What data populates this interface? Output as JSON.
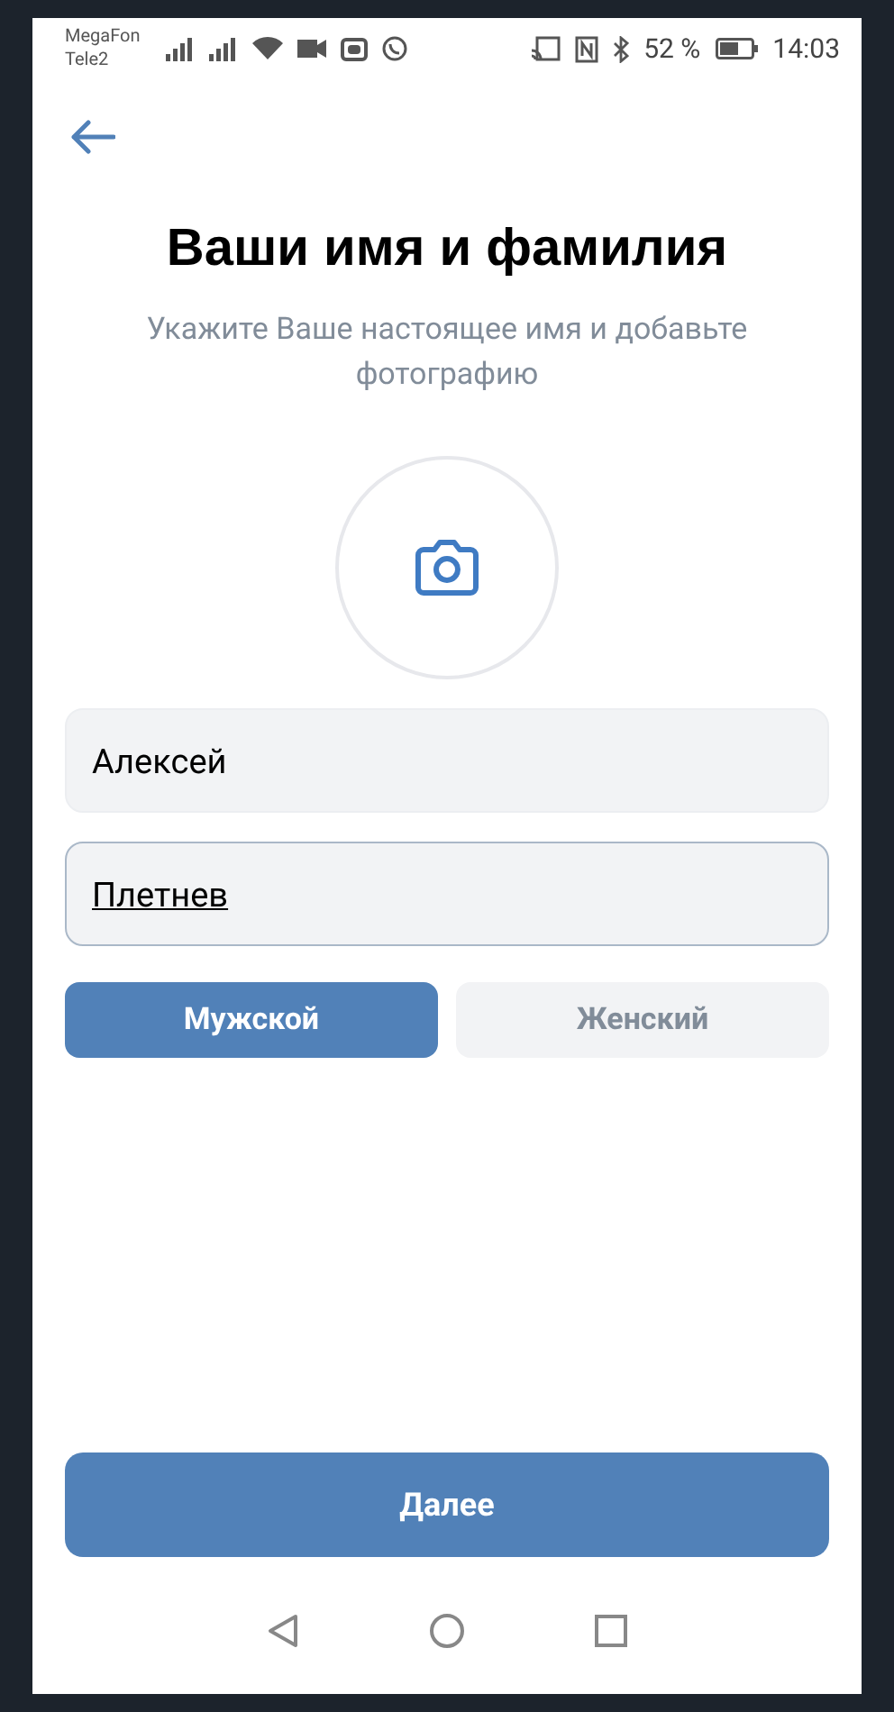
{
  "status_bar": {
    "carriers": [
      "MegaFon",
      "Tele2"
    ],
    "battery": "52 %",
    "time": "14:03"
  },
  "title": "Ваши имя и фамилия",
  "subtitle": "Укажите Ваше настоящее имя и добавьте фотографию",
  "fields": [
    {
      "value": "Алексей",
      "focused": false
    },
    {
      "value": "Плетнев",
      "focused": true
    }
  ],
  "gender": [
    {
      "label": "Мужской",
      "selected": true
    },
    {
      "label": "Женский",
      "selected": false
    }
  ],
  "next_button": "Далее"
}
